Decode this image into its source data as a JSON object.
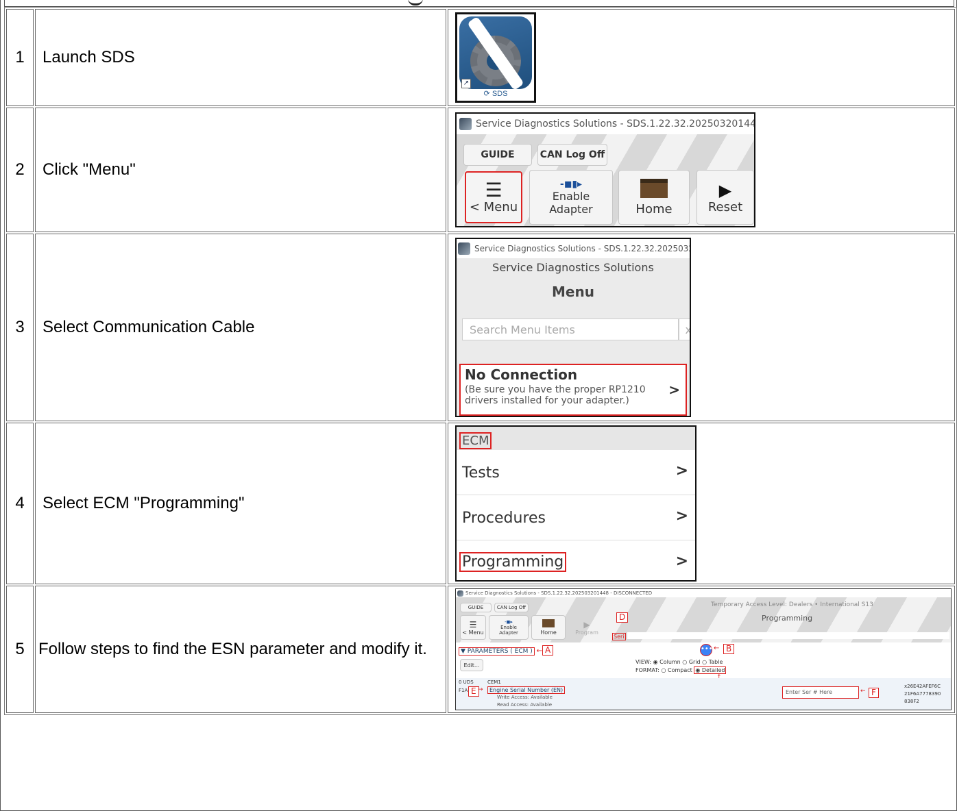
{
  "steps": [
    {
      "num": "1",
      "text": "Launch SDS"
    },
    {
      "num": "2",
      "text": "Click \"Menu\""
    },
    {
      "num": "3",
      "text": "Select Communication Cable"
    },
    {
      "num": "4",
      "text": "Select ECM \"Programming\""
    },
    {
      "num": "5",
      "text": "Follow steps to find the ESN parameter and modify it."
    }
  ],
  "icon": {
    "label": "SDS"
  },
  "window_title": "Service Diagnostics Solutions - SDS.1.22.32.202503201448 - DIS",
  "window_title_short": "Service Diagnostics Solutions - SDS.1.22.32.20250320",
  "window_title_full": "Service Diagnostics Solutions - SDS.1.22.32.202503201448 - DISCONNECTED",
  "toolbar": {
    "guide": "GUIDE",
    "can_log": "CAN Log Off",
    "menu": "< Menu",
    "enable_adapter": [
      "Enable",
      "Adapter"
    ],
    "home": "Home",
    "reset": "Reset",
    "program": "Program"
  },
  "menu_panel": {
    "app_name": "Service Diagnostics Solutions",
    "heading": "Menu",
    "search_placeholder": "Search Menu Items",
    "clear": "x",
    "conn_title": "No Connection",
    "conn_note_1": "(Be sure you have the proper RP1210",
    "conn_note_2": "drivers installed for your adapter.)",
    "chevron": ">"
  },
  "ecm_panel": {
    "header": "ECM",
    "items": [
      "Tests",
      "Procedures",
      "Programming"
    ],
    "chevron": ">"
  },
  "param_screen": {
    "access": "Temporary Access Level: Dealers • International S13",
    "title": "Programming",
    "serial_stub": "Seri",
    "section": "▼ PARAMETERS ( ECM )",
    "edit": "Edit...",
    "view_label": "VIEW:",
    "view_options": [
      "Column",
      "Grid",
      "Table"
    ],
    "format_label": "FORMAT:",
    "format_options": [
      "Compact",
      "Detailed"
    ],
    "left_codes": [
      "0 UDS",
      "F1A"
    ],
    "module": "CEM1",
    "param_name": "Engine Serial Number (EN)",
    "write": "Write Access: Available",
    "read": "Read Access: Available",
    "input_placeholder": "Enter Ser # Here",
    "hex_lines": [
      "x26E42AFEF6C",
      "21F6A7778390",
      "838F2"
    ],
    "callouts": {
      "a": "A",
      "b": "B",
      "c": "C",
      "d": "D",
      "e": "E",
      "f": "F"
    }
  }
}
